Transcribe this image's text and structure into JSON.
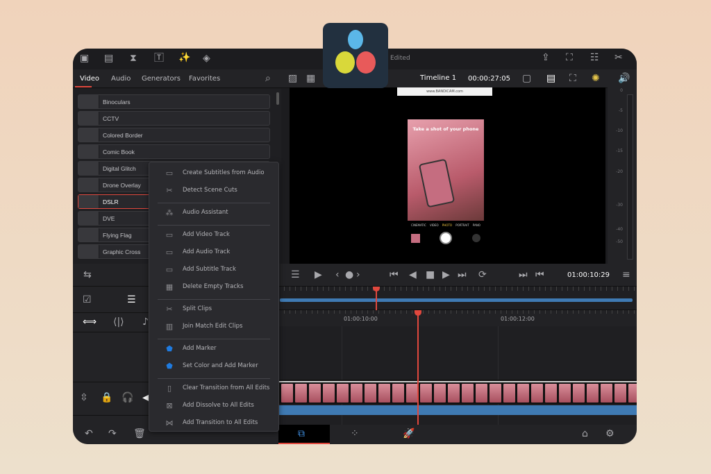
{
  "topbar": {
    "status": "Edited",
    "left_icons": [
      "media-icon",
      "cut-icon",
      "edit-icon",
      "title-icon",
      "effects-wand-icon",
      "transitions-icon"
    ],
    "right_icons": [
      "export-icon",
      "fullscreen-icon",
      "mixer-icon",
      "tools-icon"
    ]
  },
  "library": {
    "tabs": [
      "Video",
      "Audio",
      "Generators",
      "Favorites"
    ],
    "active_tab": "Video",
    "items": [
      "Binoculars",
      "CCTV",
      "Colored Border",
      "Comic Book",
      "Digital Glitch",
      "Drone Overlay",
      "DSLR",
      "DVE",
      "Flying Flag",
      "Graphic Cross"
    ],
    "selected": "DSLR"
  },
  "viewer": {
    "timeline_name": "Timeline 1",
    "duration": "00:00:27:05",
    "overlay_text": "Take a shot of your phone",
    "camera_modes": [
      "CINEMATIC",
      "VIDEO",
      "PHOTO",
      "PORTRAIT",
      "PANO"
    ],
    "browser_text": "www.BANDICAM.com"
  },
  "meter": {
    "ticks": [
      "0",
      "-5",
      "-10",
      "-15",
      "-20",
      "-30",
      "-40",
      "-50"
    ]
  },
  "transport": {
    "timecode": "01:00:10:29"
  },
  "ruler": {
    "labels": [
      "01:00:10:00",
      "01:00:12:00"
    ]
  },
  "menu": {
    "groups": [
      [
        {
          "label": "Create Subtitles from Audio",
          "icon": "subtitles-icon"
        },
        {
          "label": "Detect Scene Cuts",
          "icon": "scene-cut-icon"
        }
      ],
      [
        {
          "label": "Audio Assistant",
          "icon": "audio-assistant-icon"
        }
      ],
      [
        {
          "label": "Add Video Track",
          "icon": "add-video-track-icon"
        },
        {
          "label": "Add Audio Track",
          "icon": "add-audio-track-icon"
        },
        {
          "label": "Add Subtitle Track",
          "icon": "add-subtitle-track-icon"
        },
        {
          "label": "Delete Empty Tracks",
          "icon": "delete-tracks-icon"
        }
      ],
      [
        {
          "label": "Split Clips",
          "icon": "scissors-icon"
        },
        {
          "label": "Join Match Edit Clips",
          "icon": "join-icon"
        }
      ],
      [
        {
          "label": "Add Marker",
          "icon": "marker-icon"
        },
        {
          "label": "Set Color and Add Marker",
          "icon": "color-marker-icon"
        }
      ],
      [
        {
          "label": "Clear Transition from All Edits",
          "icon": "clear-transition-icon"
        },
        {
          "label": "Add Dissolve to All Edits",
          "icon": "dissolve-icon"
        },
        {
          "label": "Add Transition to All Edits",
          "icon": "transition-icon"
        }
      ]
    ]
  },
  "colors": {
    "accent": "#e0483e",
    "track": "#3f7ab3",
    "marker": "#1f7be0"
  }
}
